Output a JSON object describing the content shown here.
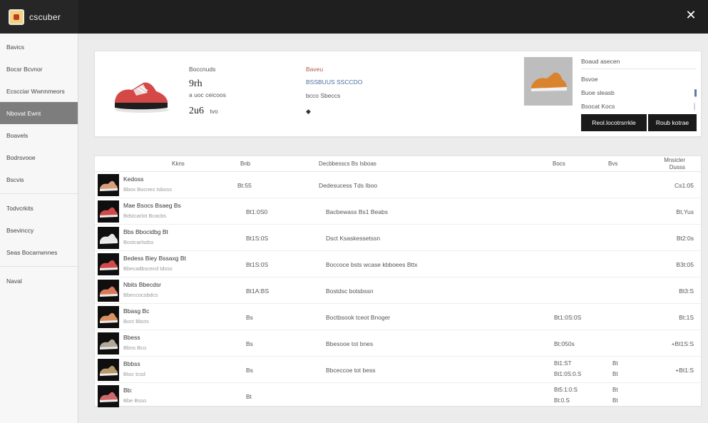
{
  "app": {
    "title": "cscuber"
  },
  "sidebar": {
    "items": [
      {
        "label": "Bavics"
      },
      {
        "label": "Bocsr Bcvnor"
      },
      {
        "label": "Ecscciar Wwnnmeors"
      },
      {
        "label": "Nbovat Ewnt",
        "active": true
      },
      {
        "label": "Boavels"
      },
      {
        "label": "Bodrsvooe"
      },
      {
        "label": "Bscvis"
      },
      {
        "label": "Todvcrkits"
      },
      {
        "label": "Bsevinccy"
      },
      {
        "label": "Seas Bocarrwnnes"
      },
      {
        "label": "Naval"
      }
    ]
  },
  "product": {
    "label": "Boccnuds",
    "line1": "9rh",
    "line2": "a uoc ceicoos",
    "price": "2u6",
    "price_unit": "tvo",
    "brand_label": "Baveu",
    "brand_link": "BSSBUUS SSCCDO",
    "size_text": "bcco Sbeccs"
  },
  "right_panel": {
    "header": "Boaud asecen",
    "rows": [
      {
        "label": "Bsvoe",
        "value": ""
      },
      {
        "label": "Buoe sleasb",
        "value": "▐"
      },
      {
        "label": "Bsocat Kocs",
        "value": "│"
      }
    ],
    "btn_primary": "Reol.locotrsrrkle",
    "btn_secondary": "Roub kotrae"
  },
  "table": {
    "headers": {
      "item": "Kkns",
      "sku": "Bnb",
      "desc": "Decbbesscs Bs Isboas",
      "size": "Bocs",
      "qty": "Bvs",
      "price": "Mnsicler\nDusss"
    },
    "rows": [
      {
        "name": "Kedoss",
        "sub": "Bbox Bocnes Isboss",
        "sku": "Bt:55",
        "desc": "Dedesucess Tds Iboo",
        "size": "",
        "qty": "",
        "price": "Cs1:05",
        "shoe_color": "#d8a07a"
      },
      {
        "name": "Mae Bsocs Bsaeg Bs",
        "sub": "Bdstcarlot Bcacbs",
        "sku": "Bt1:0S0",
        "desc": "Bacbewass Bs1 Beabs",
        "size": "",
        "qty": "",
        "price": "Bt,Yus",
        "shoe_color": "#d14a4a"
      },
      {
        "name": "Bbs Bbocidbg Bt",
        "sub": "Bostcarlsdss",
        "sku": "Bt1S:0S",
        "desc": "Dsct Ksaskessetssn",
        "size": "",
        "qty": "",
        "price": "Bt2:0s",
        "shoe_color": "#e8e8e8"
      },
      {
        "name": "Bedess Biey Bssaxg Bt",
        "sub": "Bbecadbscecd tdsss",
        "sku": "Bt1S:0S",
        "desc": "Boccoce bsts wcase kbboees Bttx",
        "size": "",
        "qty": "",
        "price": "B3t:05",
        "shoe_color": "#d14a4a"
      },
      {
        "name": "Nbits Bbecdsr",
        "sub": "Bbeccocsbdcs",
        "sku": "Bt1A:BS",
        "desc": "Bostdsc botsbssn",
        "size": "",
        "qty": "",
        "price": "Bt3:S",
        "shoe_color": "#d87a5a"
      },
      {
        "name": "Bbasg Bc",
        "sub": "Boct Bbcts",
        "sku": "Bs",
        "desc": "Boctbsook tceot Bnoger",
        "size": "Bt1:0S:0S",
        "qty": "",
        "price": "Bt:1S",
        "shoe_color": "#d89060"
      },
      {
        "name": "Bbess",
        "sub": "Bbns Bco",
        "sku": "Bs",
        "desc": "Bbesooe tot bnes",
        "size": "Bt:050s",
        "qty": "",
        "price": "+Bt1S:S",
        "shoe_color": "#b0a898"
      },
      {
        "name": "Bbbss",
        "sub": "Btoc tcsd",
        "sku": "Bs",
        "desc": "Bbceccoe tot bess",
        "size2": [
          "Bt1:ST",
          "Bt1:0S:0.S"
        ],
        "qty2": [
          "Bt",
          "Bt"
        ],
        "price": "+Bt1:S",
        "shoe_color": "#b89868"
      },
      {
        "name": "Bb:",
        "sub": "Bbe Bsso",
        "sku": "Bt",
        "desc": "",
        "size2": [
          "Bt5:1:0:S",
          "Bt:0.S"
        ],
        "qty2": [
          "Bt",
          "Bt"
        ],
        "price": "",
        "shoe_color": "#d06a6a"
      }
    ]
  }
}
